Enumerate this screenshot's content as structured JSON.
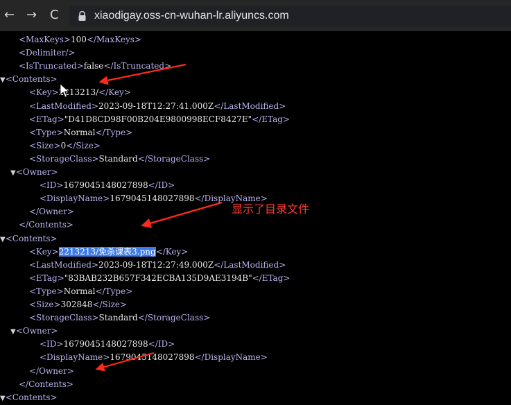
{
  "browser": {
    "back_icon": "←",
    "forward_icon": "→",
    "reload_icon": "C",
    "url": "xiaodigay.oss-cn-wuhan-lr.aliyuncs.com"
  },
  "lines": [
    {
      "indent": 2,
      "toggle": "",
      "parts": [
        [
          "tag",
          "<MaxKeys>"
        ],
        [
          "val",
          "100"
        ],
        [
          "tag",
          "</MaxKeys>"
        ]
      ]
    },
    {
      "indent": 2,
      "toggle": "",
      "parts": [
        [
          "tag",
          "<Delimiter/>"
        ]
      ]
    },
    {
      "indent": 2,
      "toggle": "",
      "parts": [
        [
          "tag",
          "<IsTruncated>"
        ],
        [
          "val",
          "false"
        ],
        [
          "tag",
          "</IsTruncated>"
        ]
      ]
    },
    {
      "indent": 0,
      "toggle": "▼",
      "parts": [
        [
          "tag",
          "<Contents>"
        ]
      ]
    },
    {
      "indent": 4,
      "toggle": "",
      "parts": [
        [
          "tag",
          "<Key>"
        ],
        [
          "val",
          "2213213/"
        ],
        [
          "tag",
          "</Key>"
        ]
      ]
    },
    {
      "indent": 4,
      "toggle": "",
      "parts": [
        [
          "tag",
          "<LastModified>"
        ],
        [
          "val",
          "2023-09-18T12:27:41.000Z"
        ],
        [
          "tag",
          "</LastModified>"
        ]
      ]
    },
    {
      "indent": 4,
      "toggle": "",
      "parts": [
        [
          "tag",
          "<ETag>"
        ],
        [
          "val",
          "\"D41D8CD98F00B204E9800998ECF8427E\""
        ],
        [
          "tag",
          "</ETag>"
        ]
      ]
    },
    {
      "indent": 4,
      "toggle": "",
      "parts": [
        [
          "tag",
          "<Type>"
        ],
        [
          "val",
          "Normal"
        ],
        [
          "tag",
          "</Type>"
        ]
      ]
    },
    {
      "indent": 4,
      "toggle": "",
      "parts": [
        [
          "tag",
          "<Size>"
        ],
        [
          "val",
          "0"
        ],
        [
          "tag",
          "</Size>"
        ]
      ]
    },
    {
      "indent": 4,
      "toggle": "",
      "parts": [
        [
          "tag",
          "<StorageClass>"
        ],
        [
          "val",
          "Standard"
        ],
        [
          "tag",
          "</StorageClass>"
        ]
      ]
    },
    {
      "indent": 2,
      "toggle": "▼",
      "parts": [
        [
          "tag",
          "<Owner>"
        ]
      ]
    },
    {
      "indent": 6,
      "toggle": "",
      "parts": [
        [
          "tag",
          "<ID>"
        ],
        [
          "val",
          "1679045148027898"
        ],
        [
          "tag",
          "</ID>"
        ]
      ]
    },
    {
      "indent": 6,
      "toggle": "",
      "parts": [
        [
          "tag",
          "<DisplayName>"
        ],
        [
          "val",
          "1679045148027898"
        ],
        [
          "tag",
          "</DisplayName>"
        ]
      ]
    },
    {
      "indent": 4,
      "toggle": "",
      "parts": [
        [
          "tag",
          "</Owner>"
        ]
      ]
    },
    {
      "indent": 2,
      "toggle": "",
      "parts": [
        [
          "tag",
          "</Contents>"
        ]
      ]
    },
    {
      "indent": 0,
      "toggle": "▼",
      "parts": [
        [
          "tag",
          "<Contents>"
        ]
      ]
    },
    {
      "indent": 4,
      "toggle": "",
      "parts": [
        [
          "tag",
          "<Key>"
        ],
        [
          "hl",
          "2213213/免杀课表3.png"
        ],
        [
          "tag",
          "</Key>"
        ]
      ]
    },
    {
      "indent": 4,
      "toggle": "",
      "parts": [
        [
          "tag",
          "<LastModified>"
        ],
        [
          "val",
          "2023-09-18T12:27:49.000Z"
        ],
        [
          "tag",
          "</LastModified>"
        ]
      ]
    },
    {
      "indent": 4,
      "toggle": "",
      "parts": [
        [
          "tag",
          "<ETag>"
        ],
        [
          "val",
          "\"83BAB232B657F342ECBA135D9AE3194B\""
        ],
        [
          "tag",
          "</ETag>"
        ]
      ]
    },
    {
      "indent": 4,
      "toggle": "",
      "parts": [
        [
          "tag",
          "<Type>"
        ],
        [
          "val",
          "Normal"
        ],
        [
          "tag",
          "</Type>"
        ]
      ]
    },
    {
      "indent": 4,
      "toggle": "",
      "parts": [
        [
          "tag",
          "<Size>"
        ],
        [
          "val",
          "302848"
        ],
        [
          "tag",
          "</Size>"
        ]
      ]
    },
    {
      "indent": 4,
      "toggle": "",
      "parts": [
        [
          "tag",
          "<StorageClass>"
        ],
        [
          "val",
          "Standard"
        ],
        [
          "tag",
          "</StorageClass>"
        ]
      ]
    },
    {
      "indent": 2,
      "toggle": "▼",
      "parts": [
        [
          "tag",
          "<Owner>"
        ]
      ]
    },
    {
      "indent": 6,
      "toggle": "",
      "parts": [
        [
          "tag",
          "<ID>"
        ],
        [
          "val",
          "1679045148027898"
        ],
        [
          "tag",
          "</ID>"
        ]
      ]
    },
    {
      "indent": 6,
      "toggle": "",
      "parts": [
        [
          "tag",
          "<DisplayName>"
        ],
        [
          "val",
          "1679045148027898"
        ],
        [
          "tag",
          "</DisplayName>"
        ]
      ]
    },
    {
      "indent": 4,
      "toggle": "",
      "parts": [
        [
          "tag",
          "</Owner>"
        ]
      ]
    },
    {
      "indent": 2,
      "toggle": "",
      "parts": [
        [
          "tag",
          "</Contents>"
        ]
      ]
    },
    {
      "indent": 0,
      "toggle": "▼",
      "parts": [
        [
          "tag",
          "<Contents>"
        ]
      ]
    }
  ],
  "annotation": {
    "text": "显示了目录文件",
    "color": "#ff3b30"
  },
  "colors": {
    "tag": "#b9b5f0",
    "value": "#e8e8e8",
    "highlight": "#3d7be8",
    "background": "#000000",
    "toolbar": "#262626"
  }
}
